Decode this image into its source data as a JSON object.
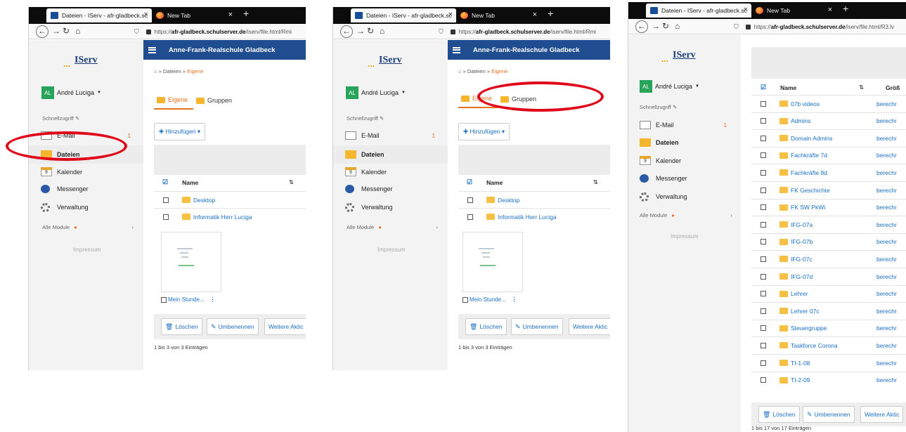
{
  "browser": {
    "tab_active_title": "Dateien - IServ - afr-gladbeck.sc",
    "tab_new": "New Tab",
    "tab_close": "×",
    "tab_plus": "+",
    "url_prefix": "https://",
    "url_domain": "afr-gladbeck.schulserver.de",
    "url_path_1": "/iserv/file.html/Rmi",
    "url_path_2": "/iserv/file.html/Rmi",
    "url_path_3": "/iserv/file.html/R3.lv"
  },
  "brand": {
    "logo": "IServ",
    "logo_dots": "...",
    "school": "Anne-Frank-Realschule Gladbeck"
  },
  "user": {
    "initials": "AL",
    "name": "André Luciga"
  },
  "sidebar": {
    "shortcut_label": "Schnellzugriff",
    "mail": "E-Mail",
    "mail_count": "1",
    "files": "Dateien",
    "calendar": "Kalender",
    "calendar_day": "9",
    "messenger": "Messenger",
    "admin": "Verwaltung",
    "all_modules": "Alle Module",
    "impressum": "Impressum"
  },
  "breadcrumb": {
    "sep": "»",
    "root": "Dateien",
    "current": "Eigene"
  },
  "tabs": {
    "own": "Eigene",
    "groups": "Gruppen"
  },
  "toolbar": {
    "add": "Hinzufügen"
  },
  "table": {
    "col_name": "Name",
    "col_size": "Größ",
    "own_rows": [
      "Desktop",
      "Informatik Herr Luciga"
    ],
    "file_label": "Mein Stunde...",
    "group_rows": [
      "07b videos",
      "Admins",
      "Domain Admins",
      "Fachkräfte 7d",
      "Fachkräfte 8d",
      "FK Geschichte",
      "FK SW PkWi",
      "IFG-07a",
      "IFG-07b",
      "IFG-07c",
      "IFG-07d",
      "Lehrer",
      "Lehrer 07c",
      "Steuergruppe",
      "Taskforce Corona",
      "TI-1-08",
      "TI-2-09"
    ],
    "size_text": "berechr"
  },
  "actions": {
    "delete": "Löschen",
    "rename": "Umbenennen",
    "more": "Weitere Aktic"
  },
  "counts": {
    "own": "1 bis 3 von 3 Einträgen",
    "groups": "1 bis 17 von 17 Einträgen"
  },
  "colors": {
    "header": "#1f4d8f",
    "accent": "#e6711d",
    "link": "#1a6fc2",
    "highlight_ring": "#e0061a"
  }
}
